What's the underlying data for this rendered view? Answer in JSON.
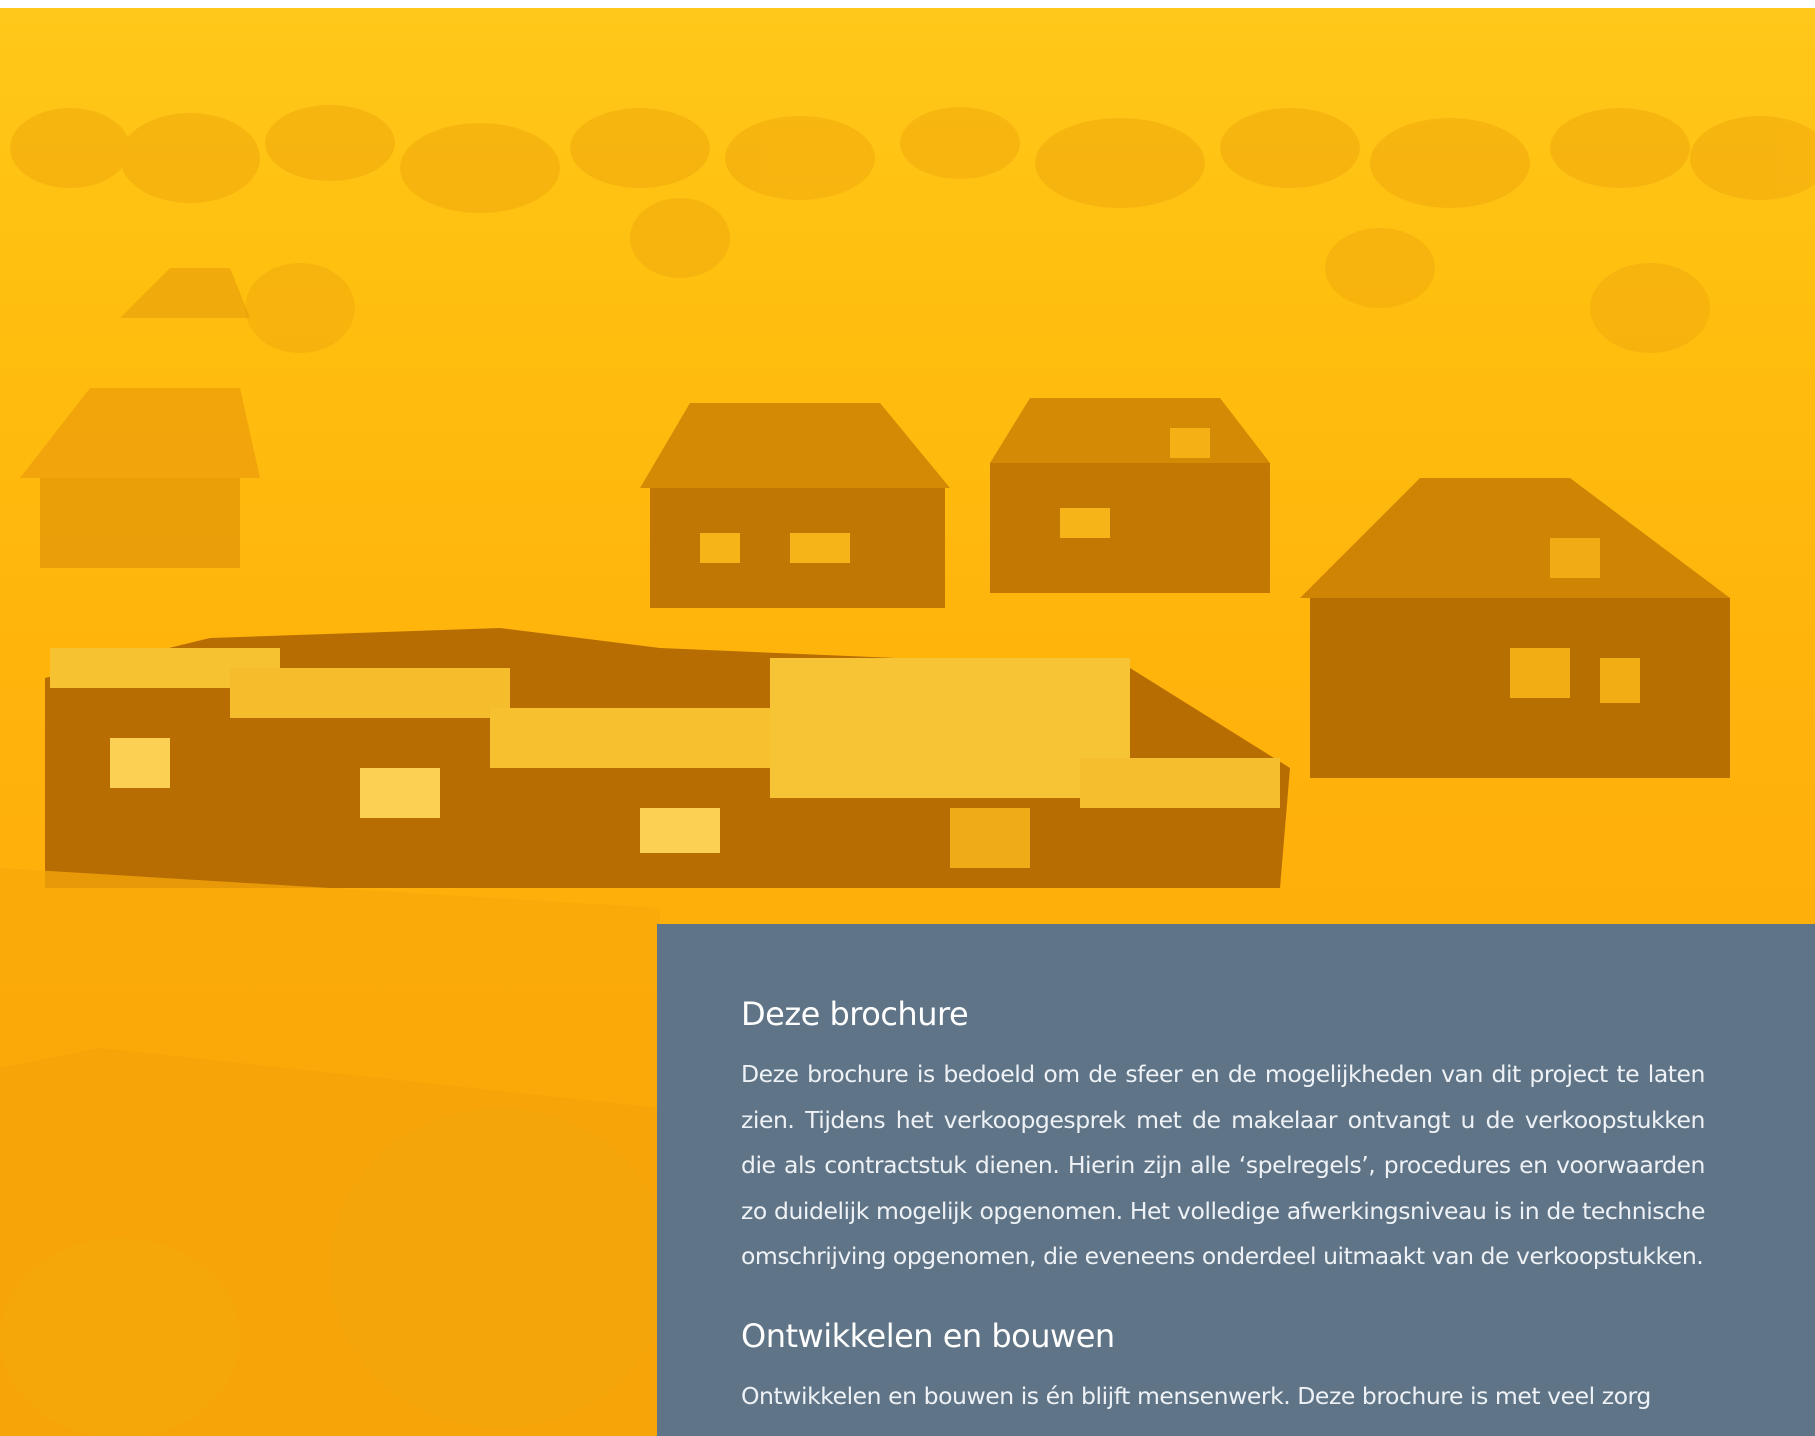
{
  "brochure": {
    "title": "Deze brochure",
    "body": "Deze brochure is bedoeld om de sfeer en de mogelijkheden van dit project te laten zien. Tijdens het verkoopgesprek met de makelaar ontvangt u de verkoopstukken die als contractstuk dienen. Hierin zijn alle ‘spelregels’, procedures en voorwaarden zo duidelijk mogelijk opgenomen. Het volledige afwerkingsniveau is in de technische omschrijving opgenomen, die eveneens onderdeel uitmaakt van de verkoopstukken."
  },
  "development": {
    "title": "Ontwikkelen en bouwen",
    "body": "Ontwikkelen en bouwen is én blijft mensenwerk. Deze brochure is met veel zorg"
  },
  "colors": {
    "hero_tint": "#ffb70f",
    "panel_background": "#5f7486",
    "text": "#ffffff"
  }
}
